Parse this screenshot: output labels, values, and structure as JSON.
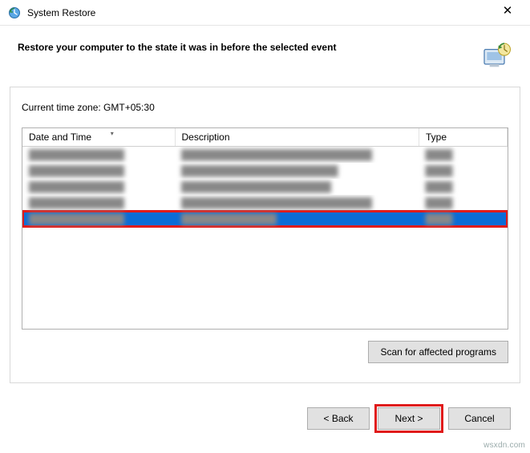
{
  "window": {
    "title": "System Restore",
    "close_glyph": "✕"
  },
  "header": {
    "heading": "Restore your computer to the state it was in before the selected event"
  },
  "timezone_label": "Current time zone: GMT+05:30",
  "table": {
    "columns": {
      "datetime": "Date and Time",
      "description": "Description",
      "type": "Type"
    },
    "rows": [
      {
        "datetime": "██████████████",
        "description": "████████████████████████████",
        "type": "████",
        "selected": false
      },
      {
        "datetime": "██████████████",
        "description": "███████████████████████",
        "type": "████",
        "selected": false
      },
      {
        "datetime": "██████████████",
        "description": "██████████████████████",
        "type": "████",
        "selected": false
      },
      {
        "datetime": "██████████████",
        "description": "████████████████████████████",
        "type": "████",
        "selected": false
      },
      {
        "datetime": "██████████████",
        "description": "██████████████",
        "type": "████",
        "selected": true
      }
    ]
  },
  "buttons": {
    "scan": "Scan for affected programs",
    "back": "< Back",
    "next": "Next >",
    "cancel": "Cancel"
  },
  "watermark": "wsxdn.com"
}
